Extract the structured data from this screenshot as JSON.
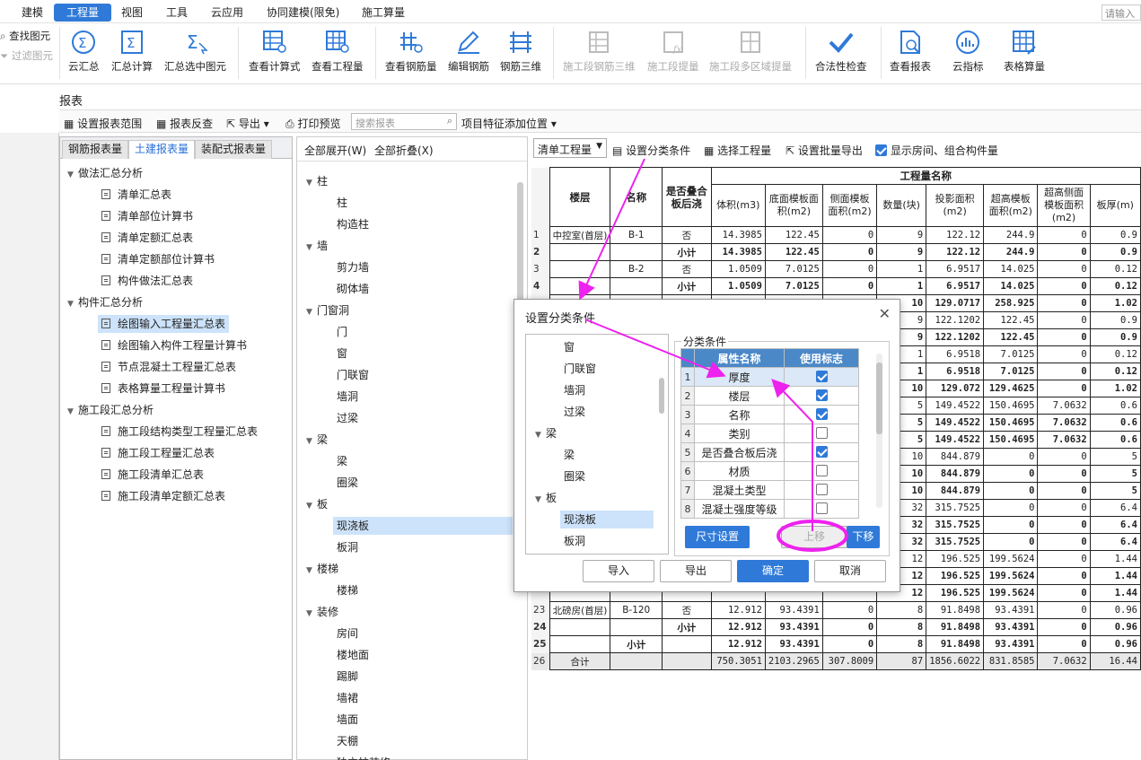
{
  "menu": {
    "items": [
      "建模",
      "工程量",
      "视图",
      "工具",
      "云应用",
      "协同建模(限免)",
      "施工算量"
    ],
    "active": "工程量",
    "search_placeholder": "请输入"
  },
  "left_tools": {
    "find": "查找图元",
    "filter": "过滤图元"
  },
  "ribbon": {
    "buttons": [
      "云汇总",
      "汇总计算",
      "汇总选中图元",
      "查看计算式",
      "查看工程量",
      "查看钢筋量",
      "编辑钢筋",
      "钢筋三维",
      "施工段钢筋三维",
      "施工段提量",
      "施工段多区域提量",
      "合法性检查",
      "查看报表",
      "云指标",
      "表格算量"
    ]
  },
  "report": {
    "title": "报表",
    "toolbar": {
      "set_range": "设置报表范围",
      "review": "报表反查",
      "export": "导出",
      "print": "打印预览",
      "search_placeholder": "搜索报表",
      "feature_pos": "项目特征添加位置"
    }
  },
  "left_panel": {
    "tabs": [
      "钢筋报表量",
      "土建报表量",
      "装配式报表量"
    ],
    "active_tab": "土建报表量",
    "groups": [
      {
        "label": "做法汇总分析",
        "items": [
          "清单汇总表",
          "清单部位计算书",
          "清单定额汇总表",
          "清单定额部位计算书",
          "构件做法汇总表"
        ]
      },
      {
        "label": "构件汇总分析",
        "items": [
          "绘图输入工程量汇总表",
          "绘图输入构件工程量计算书",
          "节点混凝土工程量汇总表",
          "表格算量工程量计算书"
        ]
      },
      {
        "label": "施工段汇总分析",
        "items": [
          "施工段结构类型工程量汇总表",
          "施工段工程量汇总表",
          "施工段清单汇总表",
          "施工段清单定额汇总表"
        ]
      }
    ],
    "selected": "绘图输入工程量汇总表"
  },
  "mid_panel": {
    "expand_all": "全部展开(W)",
    "collapse_all": "全部折叠(X)",
    "rows": [
      {
        "label": "柱",
        "level": 0
      },
      {
        "label": "柱",
        "level": 1
      },
      {
        "label": "构造柱",
        "level": 1
      },
      {
        "label": "墙",
        "level": 0
      },
      {
        "label": "剪力墙",
        "level": 1
      },
      {
        "label": "砌体墙",
        "level": 1
      },
      {
        "label": "门窗洞",
        "level": 0
      },
      {
        "label": "门",
        "level": 1
      },
      {
        "label": "窗",
        "level": 1
      },
      {
        "label": "门联窗",
        "level": 1
      },
      {
        "label": "墙洞",
        "level": 1
      },
      {
        "label": "过梁",
        "level": 1
      },
      {
        "label": "梁",
        "level": 0
      },
      {
        "label": "梁",
        "level": 1
      },
      {
        "label": "圈梁",
        "level": 1
      },
      {
        "label": "板",
        "level": 0
      },
      {
        "label": "现浇板",
        "level": 1
      },
      {
        "label": "板洞",
        "level": 1
      },
      {
        "label": "楼梯",
        "level": 0
      },
      {
        "label": "楼梯",
        "level": 1
      },
      {
        "label": "装修",
        "level": 0
      },
      {
        "label": "房间",
        "level": 1
      },
      {
        "label": "楼地面",
        "level": 1
      },
      {
        "label": "踢脚",
        "level": 1
      },
      {
        "label": "墙裙",
        "level": 1
      },
      {
        "label": "墙面",
        "level": 1
      },
      {
        "label": "天棚",
        "level": 1
      },
      {
        "label": "独立柱装修",
        "level": 1
      }
    ],
    "selected": "现浇板"
  },
  "right_toolbar": {
    "select_value": "清单工程量",
    "set_condition": "设置分类条件",
    "choose_qty": "选择工程量",
    "batch_export": "设置批量导出",
    "show_room": "显示房间、组合构件量"
  },
  "table": {
    "group_header": "工程量名称",
    "headers": [
      "楼层",
      "名称",
      "是否叠合板后浇",
      "体积(m3)",
      "底面模板面积(m2)",
      "侧面模板面积(m2)",
      "数量(块)",
      "投影面积(m2)",
      "超高模板面积(m2)",
      "超高侧面模板面积(m2)",
      "板厚(m)"
    ],
    "rows": [
      {
        "n": "1",
        "floor": "中控室(首层)",
        "name": "B-1",
        "flag": "否",
        "v": [
          "14.3985",
          "122.45",
          "0",
          "9",
          "122.12",
          "244.9",
          "0",
          "0.9"
        ],
        "bold": false
      },
      {
        "n": "2",
        "floor": "",
        "name": "",
        "flag": "小计",
        "v": [
          "14.3985",
          "122.45",
          "0",
          "9",
          "122.12",
          "244.9",
          "0",
          "0.9"
        ],
        "bold": true
      },
      {
        "n": "3",
        "floor": "",
        "name": "B-2",
        "flag": "否",
        "v": [
          "1.0509",
          "7.0125",
          "0",
          "1",
          "6.9517",
          "14.025",
          "0",
          "0.12"
        ],
        "bold": false
      },
      {
        "n": "4",
        "floor": "",
        "name": "",
        "flag": "小计",
        "v": [
          "1.0509",
          "7.0125",
          "0",
          "1",
          "6.9517",
          "14.025",
          "0",
          "0.12"
        ],
        "bold": true
      },
      {
        "n": "",
        "floor": "",
        "name": "",
        "flag": "",
        "v": [
          "",
          "",
          "",
          "10",
          "129.0717",
          "258.925",
          "0",
          "1.02"
        ],
        "bold": true
      },
      {
        "n": "",
        "floor": "",
        "name": "",
        "flag": "",
        "v": [
          "",
          "",
          "",
          "9",
          "122.1202",
          "122.45",
          "0",
          "0.9"
        ],
        "bold": false
      },
      {
        "n": "",
        "floor": "",
        "name": "",
        "flag": "",
        "v": [
          "",
          "",
          "",
          "9",
          "122.1202",
          "122.45",
          "0",
          "0.9"
        ],
        "bold": true
      },
      {
        "n": "",
        "floor": "",
        "name": "",
        "flag": "",
        "v": [
          "",
          "",
          "",
          "1",
          "6.9518",
          "7.0125",
          "0",
          "0.12"
        ],
        "bold": false
      },
      {
        "n": "",
        "floor": "",
        "name": "",
        "flag": "",
        "v": [
          "",
          "",
          "",
          "1",
          "6.9518",
          "7.0125",
          "0",
          "0.12"
        ],
        "bold": true
      },
      {
        "n": "",
        "floor": "",
        "name": "",
        "flag": "",
        "v": [
          "",
          "",
          "",
          "10",
          "129.072",
          "129.4625",
          "0",
          "1.02"
        ],
        "bold": true
      },
      {
        "n": "",
        "floor": "",
        "name": "",
        "flag": "",
        "v": [
          "",
          "",
          "",
          "5",
          "149.4522",
          "150.4695",
          "7.0632",
          "0.6"
        ],
        "bold": false
      },
      {
        "n": "",
        "floor": "",
        "name": "",
        "flag": "",
        "v": [
          "",
          "",
          "",
          "5",
          "149.4522",
          "150.4695",
          "7.0632",
          "0.6"
        ],
        "bold": true
      },
      {
        "n": "",
        "floor": "",
        "name": "",
        "flag": "",
        "v": [
          "",
          "",
          "",
          "5",
          "149.4522",
          "150.4695",
          "7.0632",
          "0.6"
        ],
        "bold": true
      },
      {
        "n": "",
        "floor": "",
        "name": "",
        "flag": "",
        "v": [
          "",
          "",
          "",
          "10",
          "844.879",
          "0",
          "0",
          "5"
        ],
        "bold": false
      },
      {
        "n": "",
        "floor": "",
        "name": "",
        "flag": "",
        "v": [
          "",
          "",
          "",
          "10",
          "844.879",
          "0",
          "0",
          "5"
        ],
        "bold": true
      },
      {
        "n": "",
        "floor": "",
        "name": "",
        "flag": "",
        "v": [
          "",
          "",
          "",
          "10",
          "844.879",
          "0",
          "0",
          "5"
        ],
        "bold": true
      },
      {
        "n": "",
        "floor": "",
        "name": "",
        "flag": "",
        "v": [
          "",
          "",
          "",
          "32",
          "315.7525",
          "0",
          "0",
          "6.4"
        ],
        "bold": false
      },
      {
        "n": "",
        "floor": "",
        "name": "",
        "flag": "",
        "v": [
          "",
          "",
          "",
          "32",
          "315.7525",
          "0",
          "0",
          "6.4"
        ],
        "bold": true
      },
      {
        "n": "",
        "floor": "",
        "name": "",
        "flag": "",
        "v": [
          "",
          "",
          "",
          "32",
          "315.7525",
          "0",
          "0",
          "6.4"
        ],
        "bold": true
      },
      {
        "n": "",
        "floor": "",
        "name": "",
        "flag": "",
        "v": [
          "",
          "",
          "",
          "12",
          "196.525",
          "199.5624",
          "0",
          "1.44"
        ],
        "bold": false
      },
      {
        "n": "",
        "floor": "",
        "name": "",
        "flag": "",
        "v": [
          "",
          "",
          "",
          "12",
          "196.525",
          "199.5624",
          "0",
          "1.44"
        ],
        "bold": true
      },
      {
        "n": "",
        "floor": "",
        "name": "",
        "flag": "",
        "v": [
          "",
          "",
          "",
          "12",
          "196.525",
          "199.5624",
          "0",
          "1.44"
        ],
        "bold": true
      },
      {
        "n": "23",
        "floor": "北磅房(首层)",
        "name": "B-120",
        "flag": "否",
        "v": [
          "12.912",
          "93.4391",
          "0",
          "8",
          "91.8498",
          "93.4391",
          "0",
          "0.96"
        ],
        "bold": false
      },
      {
        "n": "24",
        "floor": "",
        "name": "",
        "flag": "小计",
        "v": [
          "12.912",
          "93.4391",
          "0",
          "8",
          "91.8498",
          "93.4391",
          "0",
          "0.96"
        ],
        "bold": true
      },
      {
        "n": "25",
        "floor": "",
        "name": "小计",
        "flag": "",
        "v": [
          "12.912",
          "93.4391",
          "0",
          "8",
          "91.8498",
          "93.4391",
          "0",
          "0.96"
        ],
        "bold": true
      },
      {
        "n": "26",
        "floor": "合计",
        "name": "",
        "flag": "",
        "v": [
          "750.3051",
          "2103.2965",
          "307.8009",
          "87",
          "1856.6022",
          "831.8585",
          "7.0632",
          "16.44"
        ],
        "bold": false
      }
    ]
  },
  "dialog": {
    "title": "设置分类条件",
    "group_label": "分类条件",
    "col_name": "属性名称",
    "col_flag": "使用标志",
    "tree": [
      {
        "label": "窗",
        "level": 1
      },
      {
        "label": "门联窗",
        "level": 1
      },
      {
        "label": "墙洞",
        "level": 1
      },
      {
        "label": "过梁",
        "level": 1
      },
      {
        "label": "梁",
        "level": 0
      },
      {
        "label": "梁",
        "level": 1
      },
      {
        "label": "圈梁",
        "level": 1
      },
      {
        "label": "板",
        "level": 0
      },
      {
        "label": "现浇板",
        "level": 1
      },
      {
        "label": "板洞",
        "level": 1
      }
    ],
    "tree_selected": "现浇板",
    "conditions": [
      {
        "idx": "1",
        "name": "厚度",
        "on": true
      },
      {
        "idx": "2",
        "name": "楼层",
        "on": true
      },
      {
        "idx": "3",
        "name": "名称",
        "on": true
      },
      {
        "idx": "4",
        "name": "类别",
        "on": false
      },
      {
        "idx": "5",
        "name": "是否叠合板后浇",
        "on": true
      },
      {
        "idx": "6",
        "name": "材质",
        "on": false
      },
      {
        "idx": "7",
        "name": "混凝土类型",
        "on": false
      },
      {
        "idx": "8",
        "name": "混凝土强度等级",
        "on": false
      }
    ],
    "size_setting": "尺寸设置",
    "move_up": "上移",
    "move_down": "下移",
    "import": "导入",
    "export": "导出",
    "ok": "确定",
    "cancel": "取消"
  },
  "colors": {
    "accent": "#2f7ad8",
    "annotation": "#ee22ee",
    "header_blue": "#4a88c8"
  },
  "footer_row_label": "小计"
}
